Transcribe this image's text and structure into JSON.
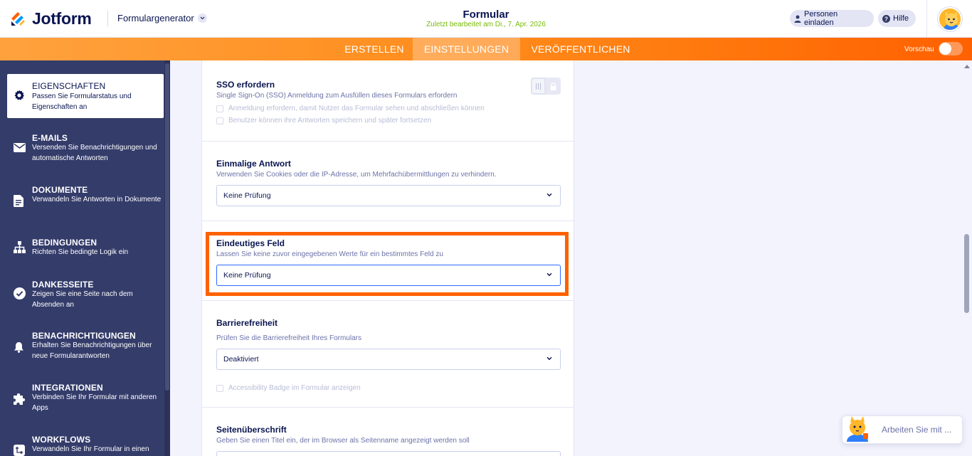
{
  "header": {
    "brand": "Jotform",
    "app_selector": "Formulargenerator",
    "form_title": "Formular",
    "last_edited": "Zuletzt bearbeitet am Di., 7. Apr. 2026",
    "invite_button": "Personen einladen",
    "help_button": "Hilfe"
  },
  "nav": {
    "tabs": [
      "ERSTELLEN",
      "EINSTELLUNGEN",
      "VERÖFFENTLICHEN"
    ],
    "active_tab": "EINSTELLUNGEN",
    "preview_label": "Vorschau",
    "preview_enabled": false
  },
  "sidebar": {
    "items": [
      {
        "title": "EIGENSCHAFTEN",
        "desc": "Passen Sie Formularstatus und Eigenschaften an",
        "icon": "gear-icon",
        "active": true
      },
      {
        "title": "E-MAILS",
        "desc": "Versenden Sie Benachrichtigungen und automatische Antworten",
        "icon": "envelope-icon"
      },
      {
        "title": "DOKUMENTE",
        "desc": "Verwandeln Sie Antworten in Dokumente",
        "icon": "document-icon"
      },
      {
        "title": "BEDINGUNGEN",
        "desc": "Richten Sie bedingte Logik ein",
        "icon": "sitemap-icon"
      },
      {
        "title": "DANKESSEITE",
        "desc": "Zeigen Sie eine Seite nach dem Absenden an",
        "icon": "check-circle-icon"
      },
      {
        "title": "BENACHRICHTIGUNGEN",
        "desc": "Erhalten Sie Benachrichtigungen über neue Formularantworten",
        "icon": "bell-icon"
      },
      {
        "title": "INTEGRATIONEN",
        "desc": "Verbinden Sie Ihr Formular mit anderen Apps",
        "icon": "puzzle-icon"
      },
      {
        "title": "WORKFLOWS",
        "desc": "Verwandeln Sie Ihr Formular in einen",
        "icon": "workflow-icon"
      }
    ]
  },
  "settings": {
    "sso": {
      "title": "SSO erfordern",
      "desc": "Single Sign-On (SSO) Anmeldung zum Ausfüllen dieses Formulars erfordern",
      "option1": "Anmeldung erfordern, damit Nutzer das Formular sehen und abschließen können",
      "option2": "Benutzer können ihre Antworten speichern und später fortsetzen",
      "locked": true
    },
    "single_response": {
      "title": "Einmalige Antwort",
      "desc": "Verwenden Sie Cookies oder die IP-Adresse, um Mehrfachübermittlungen zu verhindern.",
      "value": "Keine Prüfung"
    },
    "unique_field": {
      "title": "Eindeutiges Feld",
      "desc": "Lassen Sie keine zuvor eingegebenen Werte für ein bestimmtes Feld zu",
      "value": "Keine Prüfung"
    },
    "accessibility": {
      "title": "Barrierefreiheit",
      "desc": "Prüfen Sie die Barrierefreiheit Ihres Formulars",
      "value": "Deaktiviert",
      "badge_option": "Accessibility Badge im Formular anzeigen"
    },
    "page_title": {
      "title": "Seitenüberschrift",
      "desc": "Geben Sie einen Titel ein, der im Browser als Seitenname angezeigt werden soll"
    }
  },
  "chat": {
    "text": "Arbeiten Sie mit ..."
  },
  "colors": {
    "brand_orange": "#ff6100",
    "sidebar_bg": "#343c6a",
    "navy_text": "#0a1551",
    "edited_green": "#78bb07"
  }
}
